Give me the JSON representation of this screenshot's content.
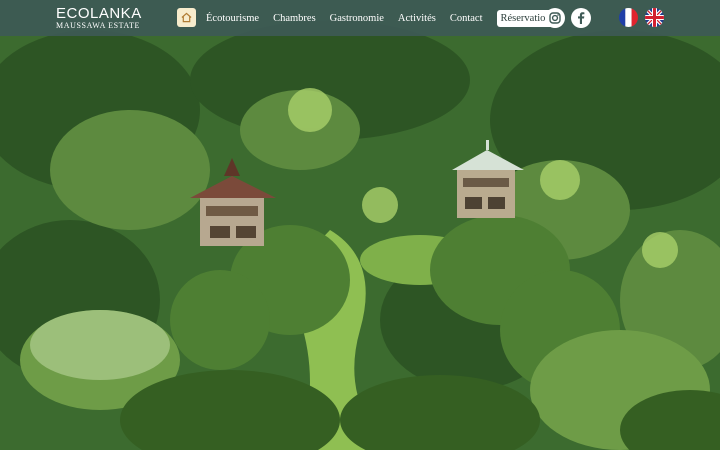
{
  "brand": {
    "name": "ECOLANKA",
    "tagline": "MAUSSAWA ESTATE"
  },
  "nav": {
    "home_icon": "home-icon",
    "items": [
      "Écotourisme",
      "Chambres",
      "Gastronomie",
      "Activités",
      "Contact"
    ],
    "cta_label": "Réservation"
  },
  "social": {
    "instagram": "instagram-icon",
    "facebook": "facebook-icon"
  },
  "languages": [
    "fr-flag-icon",
    "gb-flag-icon"
  ],
  "colors": {
    "header_bg": "#3e5a56",
    "home_button_bg": "#f7eccc",
    "cta_bg": "#ffffff"
  }
}
